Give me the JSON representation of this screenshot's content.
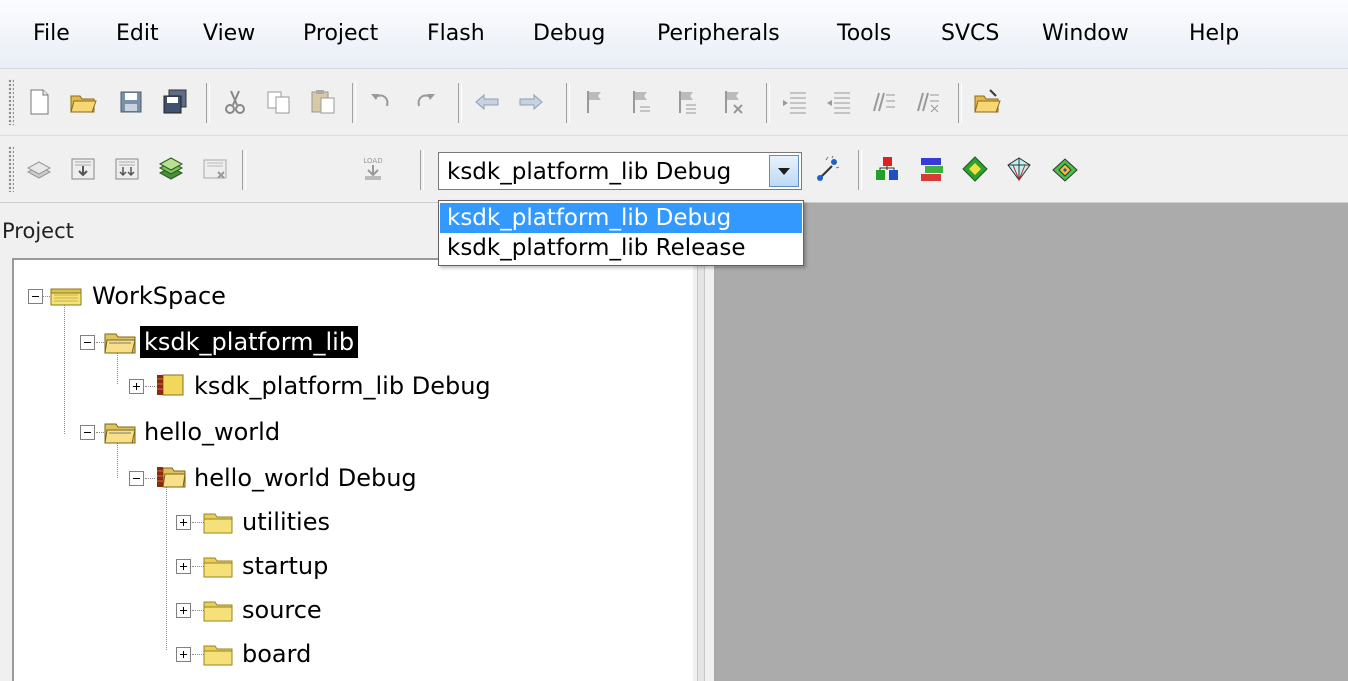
{
  "menu": [
    "File",
    "Edit",
    "View",
    "Project",
    "Flash",
    "Debug",
    "Peripherals",
    "Tools",
    "SVCS",
    "Window",
    "Help"
  ],
  "toolbar1": {
    "icons": [
      "new-file-icon",
      "open-folder-icon",
      "save-icon",
      "save-all-icon",
      "cut-icon",
      "copy-icon",
      "paste-icon",
      "undo-icon",
      "redo-icon",
      "nav-back-icon",
      "nav-forward-icon",
      "insert-bookmark-icon",
      "prev-bookmark-icon",
      "next-bookmark-icon",
      "clear-bookmarks-icon",
      "indent-icon",
      "unindent-icon",
      "comment-icon",
      "uncomment-icon",
      "find-in-files-icon"
    ]
  },
  "toolbar2": {
    "icons": [
      "translate-icon",
      "build-icon",
      "rebuild-icon",
      "batch-build-icon",
      "stop-build-icon",
      "load-icon",
      "target-options-icon",
      "manage-project-items-icon",
      "select-packs-icon",
      "manage-rte-icon",
      "pack-installer-icon",
      "event-recorder-icon"
    ],
    "load_label": "LOAD",
    "target_select": {
      "value": "ksdk_platform_lib Debug",
      "options": [
        "ksdk_platform_lib Debug",
        "ksdk_platform_lib Release"
      ],
      "selected_index": 0
    }
  },
  "project_panel": {
    "title": "Project",
    "tree": [
      {
        "label": "WorkSpace",
        "icon": "workspace-icon",
        "level": 0,
        "expander": "minus"
      },
      {
        "label": "ksdk_platform_lib",
        "icon": "project-folder-icon",
        "level": 1,
        "expander": "minus",
        "highlighted": true
      },
      {
        "label": "ksdk_platform_lib Debug",
        "icon": "target-icon",
        "level": 2,
        "expander": "plus"
      },
      {
        "label": "hello_world",
        "icon": "project-folder-icon",
        "level": 1,
        "expander": "minus"
      },
      {
        "label": "hello_world Debug",
        "icon": "target-icon",
        "level": 2,
        "expander": "minus"
      },
      {
        "label": "utilities",
        "icon": "folder-icon",
        "level": 3,
        "expander": "plus"
      },
      {
        "label": "startup",
        "icon": "folder-icon",
        "level": 3,
        "expander": "plus"
      },
      {
        "label": "source",
        "icon": "folder-icon",
        "level": 3,
        "expander": "plus"
      },
      {
        "label": "board",
        "icon": "folder-icon",
        "level": 3,
        "expander": "plus"
      }
    ]
  },
  "colors": {
    "selection": "#3399ff",
    "editor_background": "#ababab",
    "highlight": "#000000"
  }
}
